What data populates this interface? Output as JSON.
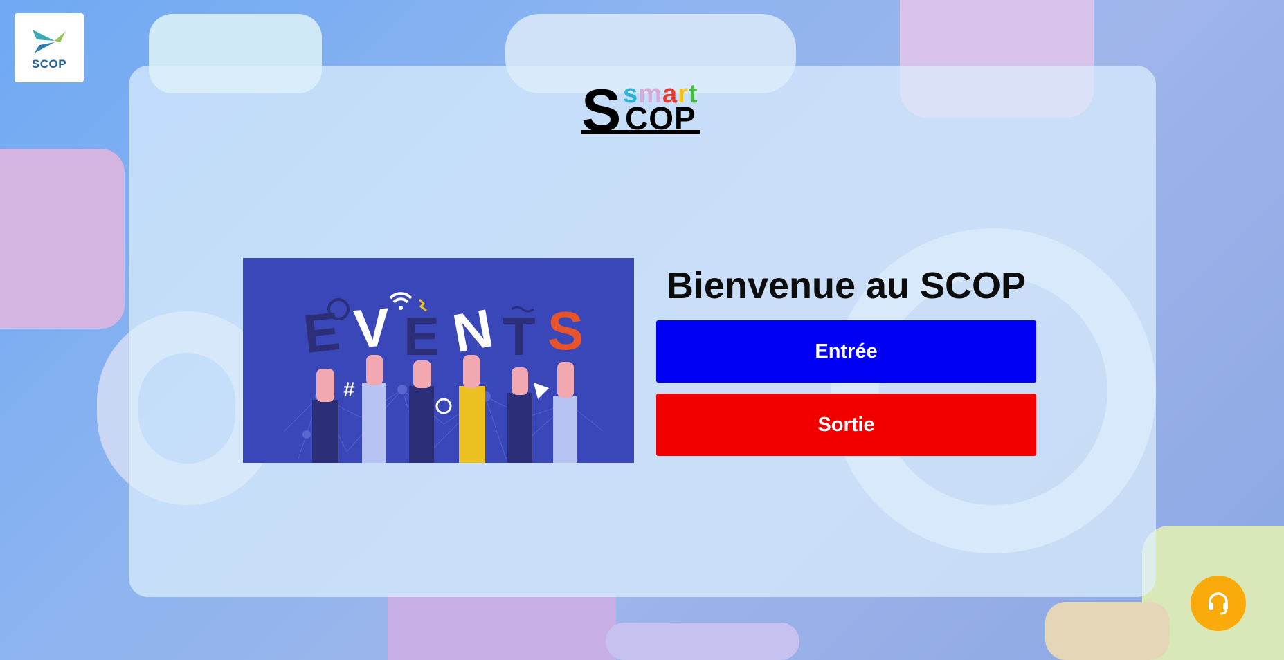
{
  "corner_logo": {
    "text": "SCOP"
  },
  "brand": {
    "smart": "smart",
    "scop_initial": "S",
    "scop_rest": "COP"
  },
  "events_image": {
    "letters": [
      "E",
      "V",
      "E",
      "N",
      "T",
      "S"
    ],
    "symbols": {
      "hash": "#"
    }
  },
  "welcome": {
    "title": "Bienvenue au SCOP",
    "entry_label": "Entrée",
    "exit_label": "Sortie"
  },
  "colors": {
    "entry_button": "#0000f4",
    "exit_button": "#f20000",
    "support_button": "#fbaa0b",
    "events_background": "#3a47b8",
    "events_highlight": "#e8542a"
  },
  "support": {
    "icon": "headset-icon"
  }
}
